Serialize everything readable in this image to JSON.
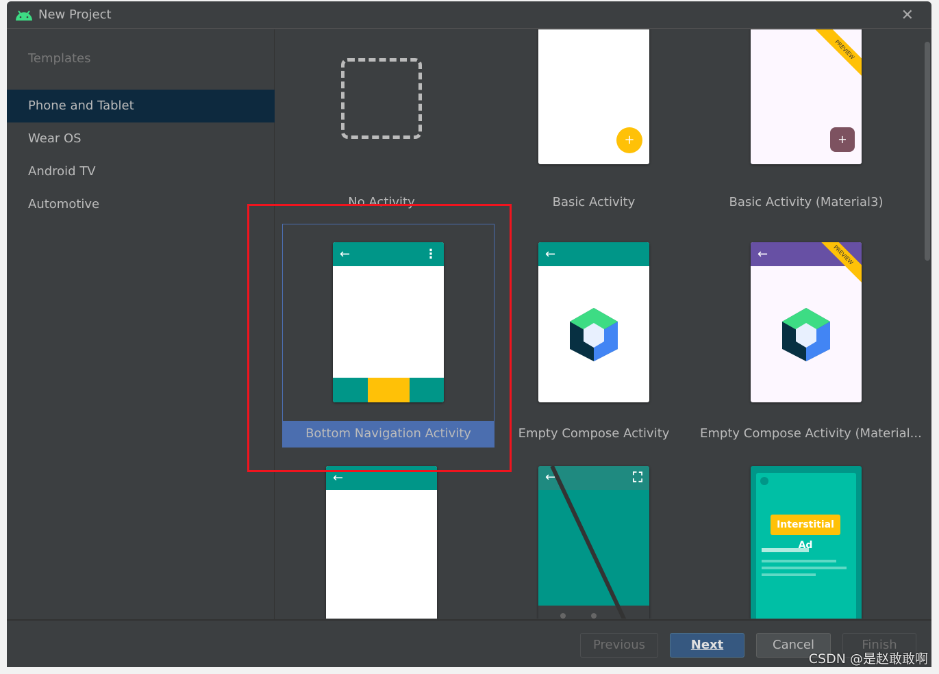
{
  "window": {
    "title": "New Project",
    "close_icon": "close-icon",
    "app_icon": "android-icon"
  },
  "sidebar": {
    "header": "Templates",
    "items": [
      {
        "label": "Phone and Tablet",
        "selected": true
      },
      {
        "label": "Wear OS"
      },
      {
        "label": "Android TV"
      },
      {
        "label": "Automotive"
      }
    ]
  },
  "templates": [
    {
      "label": "No Activity"
    },
    {
      "label": "Basic Activity"
    },
    {
      "label": "Basic Activity (Material3)",
      "badge": "PREVIEW"
    },
    {
      "label": "Bottom Navigation Activity",
      "selected": true
    },
    {
      "label": "Empty Compose Activity"
    },
    {
      "label": "Empty Compose Activity (Material...",
      "badge": "PREVIEW"
    },
    {
      "label": ""
    },
    {
      "label": ""
    },
    {
      "label": "",
      "ad_text": "Interstitial Ad"
    }
  ],
  "footer": {
    "previous": "Previous",
    "next": "Next",
    "cancel": "Cancel",
    "finish": "Finish"
  },
  "watermark": "CSDN @是赵敢敢啊",
  "colors": {
    "accent": "#4b6eaf",
    "teal": "#009688",
    "purple": "#6750a4",
    "amber": "#ffc107",
    "highlight": "#f0141e"
  }
}
